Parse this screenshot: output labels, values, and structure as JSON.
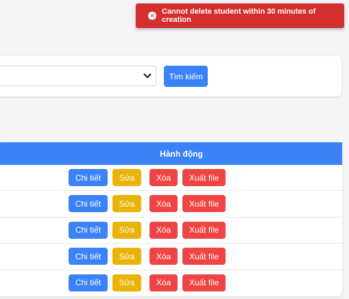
{
  "toast": {
    "message": "Cannot delete student within 30 minutes of creation",
    "icon": "close-circle-icon",
    "color": "#d32f2f"
  },
  "search": {
    "select_value": "",
    "button_label": "Tìm kiếm"
  },
  "table": {
    "header": "Hành động",
    "rows": [
      {
        "detail": "Chi tiết",
        "edit": "Sửa",
        "delete": "Xóa",
        "export": "Xuất file"
      },
      {
        "detail": "Chi tiết",
        "edit": "Sửa",
        "delete": "Xóa",
        "export": "Xuất file"
      },
      {
        "detail": "Chi tiết",
        "edit": "Sửa",
        "delete": "Xóa",
        "export": "Xuất file"
      },
      {
        "detail": "Chi tiết",
        "edit": "Sửa",
        "delete": "Xóa",
        "export": "Xuất file"
      },
      {
        "detail": "Chi tiết",
        "edit": "Sửa",
        "delete": "Xóa",
        "export": "Xuất file"
      }
    ]
  },
  "colors": {
    "primary": "#3b82f6",
    "warning": "#eab308",
    "danger": "#ef4444"
  }
}
